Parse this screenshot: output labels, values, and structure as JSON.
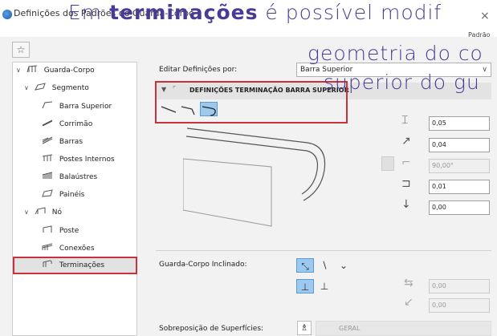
{
  "window": {
    "title": "Definições dos Padrões do Guarda-Corpo",
    "corner_label": "Padrão",
    "close_glyph": "×"
  },
  "caption": {
    "part1": "Em ",
    "bold": "terminações",
    "part2": " é possível modif",
    "line2": "geometria do co",
    "line3": "superior do gu"
  },
  "toolbar": {
    "favorites_glyph": "☆"
  },
  "tree": {
    "items": [
      {
        "label": "Guarda-Corpo",
        "chevron": "∨"
      },
      {
        "label": "Segmento",
        "chevron": "∨"
      },
      {
        "label": "Barra Superior"
      },
      {
        "label": "Corrimão"
      },
      {
        "label": "Barras"
      },
      {
        "label": "Postes Internos"
      },
      {
        "label": "Balaústres"
      },
      {
        "label": "Painéis"
      },
      {
        "label": "Nó",
        "chevron": "∨"
      },
      {
        "label": "Poste"
      },
      {
        "label": "Conexões"
      },
      {
        "label": "Terminações"
      }
    ]
  },
  "editor": {
    "label": "Editar Definições por:",
    "selected": "Barra Superior",
    "section_title": "DEFINIÇÕES TERMINAÇÃO BARRA SUPERIOR",
    "fields": [
      "0,05",
      "0,04",
      "90,00°",
      "0,01",
      "0,00"
    ]
  },
  "inclined": {
    "label": "Guarda-Corpo Inclinado:",
    "fields": [
      "0,00",
      "0,00"
    ]
  },
  "surfaces": {
    "label": "Sobreposição de Superfícies:",
    "value": "GERAL"
  },
  "colors": {
    "accent_red": "#c8323c",
    "caption": "#4a3a96",
    "selected_blue": "#9cc9ef"
  }
}
